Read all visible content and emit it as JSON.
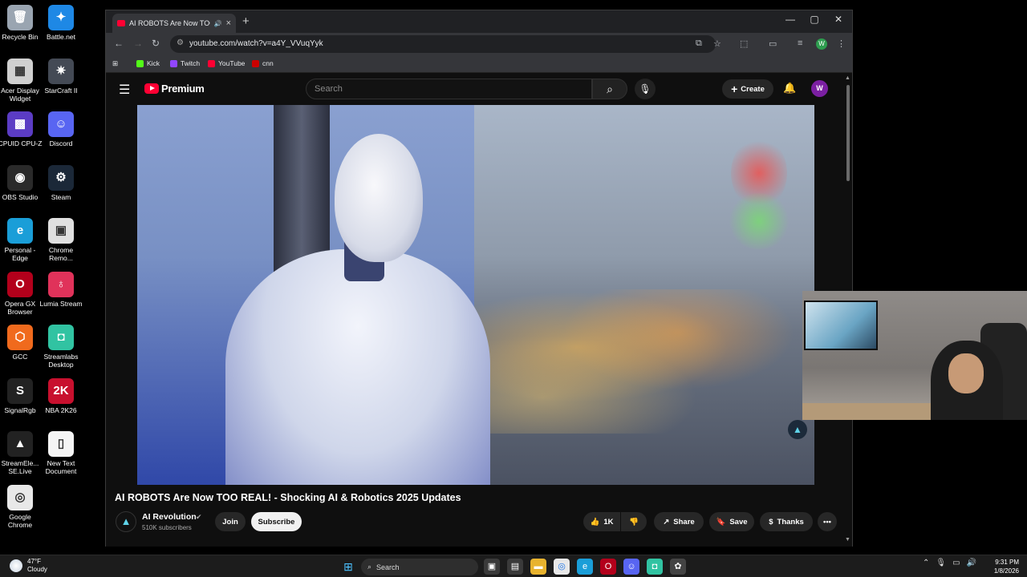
{
  "desktop": {
    "icons": [
      {
        "label": "Recycle Bin",
        "color": "#9aa5b1",
        "glyph": "🗑"
      },
      {
        "label": "Battle.net",
        "color": "#1e88e5",
        "glyph": "✦"
      },
      {
        "label": "Acer Display Widget",
        "color": "#d0d0d0",
        "glyph": "▦"
      },
      {
        "label": "StarCraft II",
        "color": "#444a55",
        "glyph": "✷"
      },
      {
        "label": "CPUID CPU-Z",
        "color": "#5b3cc4",
        "glyph": "▩"
      },
      {
        "label": "Discord",
        "color": "#5865f2",
        "glyph": "☺"
      },
      {
        "label": "OBS Studio",
        "color": "#2a2a2a",
        "glyph": "◉"
      },
      {
        "label": "Steam",
        "color": "#1b2838",
        "glyph": "⚙"
      },
      {
        "label": "Personal - Edge",
        "color": "#1a9ed8",
        "glyph": "e"
      },
      {
        "label": "Chrome Remo...",
        "color": "#e0e0e0",
        "glyph": "▣"
      },
      {
        "label": "Opera GX Browser",
        "color": "#b3001b",
        "glyph": "O"
      },
      {
        "label": "Lumia Stream",
        "color": "#e0325a",
        "glyph": "♁"
      },
      {
        "label": "GCC",
        "color": "#f06a1d",
        "glyph": "⬡"
      },
      {
        "label": "Streamlabs Desktop",
        "color": "#31c3a2",
        "glyph": "◘"
      },
      {
        "label": "SignalRgb",
        "color": "#222",
        "glyph": "S"
      },
      {
        "label": "NBA 2K26",
        "color": "#c8102e",
        "glyph": "2K"
      },
      {
        "label": "StreamEle... SE.Live",
        "color": "#222",
        "glyph": "▲"
      },
      {
        "label": "New Text Document",
        "color": "#f5f5f5",
        "glyph": "▯"
      },
      {
        "label": "Google Chrome",
        "color": "#e8e8e8",
        "glyph": "◎"
      }
    ]
  },
  "browser": {
    "tab_title": "AI ROBOTS Are Now TOO R",
    "tab_close": "×",
    "new_tab": "+",
    "url": "youtube.com/watch?v=a4Y_VVuqYyk",
    "profile_initial": "W",
    "bookmarks": [
      {
        "label": "Kick",
        "color": "#53fc18"
      },
      {
        "label": "Twitch",
        "color": "#9146ff"
      },
      {
        "label": "YouTube",
        "color": "#ff0033"
      },
      {
        "label": "cnn",
        "color": "#cc0000"
      }
    ]
  },
  "youtube": {
    "logo_word": "Premium",
    "search_placeholder": "Search",
    "create_label": "Create",
    "avatar_initial": "W",
    "video_title": "AI ROBOTS Are Now TOO REAL! - Shocking AI & Robotics 2025 Updates",
    "channel_name": "AI Revolution",
    "subscribers": "510K subscribers",
    "join_label": "Join",
    "subscribe_label": "Subscribe",
    "like_count": "1K",
    "share_label": "Share",
    "save_label": "Save",
    "thanks_label": "Thanks"
  },
  "taskbar": {
    "temperature": "47°F",
    "weather": "Cloudy",
    "search_label": "Search",
    "time": "9:31 PM",
    "date": "1/8/2026"
  }
}
